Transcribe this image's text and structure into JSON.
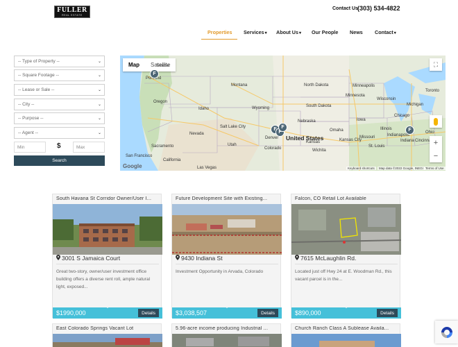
{
  "header": {
    "logo_text": "FULLER",
    "logo_sub": "REAL ESTATE",
    "contact_label": "Contact Us",
    "phone": "(303) 534-4822"
  },
  "nav": {
    "items": [
      {
        "label": "Properties",
        "active": true
      },
      {
        "label": "Services",
        "caret": "▾"
      },
      {
        "label": "About Us",
        "caret": "▾"
      },
      {
        "label": "Our People"
      },
      {
        "label": "News"
      },
      {
        "label": "Contact",
        "caret": "▾"
      }
    ]
  },
  "filters": {
    "type": "-- Type of Property --",
    "footage": "-- Square Footage --",
    "lease": "-- Lease or Sale --",
    "city": "-- City --",
    "purpose": "-- Purpose --",
    "agent": "-- Agent --",
    "min_placeholder": "Min",
    "currency": "$",
    "max_placeholder": "Max",
    "search_label": "Search",
    "dropdown_icon": "chevron-down-icon"
  },
  "map": {
    "tab_map": "Map",
    "tab_satellite": "Satellite",
    "country_label": "United States",
    "zoom_in": "+",
    "zoom_out": "−",
    "fullscreen": "⛶",
    "google": "Google",
    "attrib_shortcuts": "Keyboard shortcuts",
    "attrib_data": "Map data ©2022 Google, INEGI",
    "attrib_terms": "Terms of Use",
    "marker_glyph": "F",
    "labels": [
      "Portland",
      "Seattle",
      "Minneapolis",
      "Chicago",
      "Indianapolis",
      "Cincinnati",
      "St. Louis",
      "Denver",
      "Salt Lake City",
      "Sacramento",
      "San Francisco",
      "Las Vegas",
      "Kansas City",
      "Omaha",
      "Wichita",
      "Toronto",
      "Nebraska",
      "Kansas",
      "Iowa",
      "Illinois",
      "Missouri",
      "Wisconsin",
      "Michigan",
      "Wyoming",
      "Colorado",
      "Nevada",
      "Utah",
      "Oregon",
      "Idaho",
      "Montana",
      "South Dakota",
      "North Dakota",
      "Minnesota",
      "California",
      "Ohio",
      "Indiana"
    ]
  },
  "listings": [
    {
      "title": "South Havana St Corridor Owner/User I...",
      "address": "3001 S Jamaica Court",
      "description": "Great two-story, owner/user investment office building offers a diverse rent roll, ample natural light, exposed...",
      "price": "$1990,000",
      "details_label": "Details"
    },
    {
      "title": "Future Development Site with Existing...",
      "address": "9430 Indiana St",
      "description": "Investment Opportunity in Arvada, Colorado",
      "price": "$3,038,507",
      "details_label": "Details"
    },
    {
      "title": "Falcon, CO Retail Lot Available",
      "address": "7615 McLaughlin Rd.",
      "description": "Located just off Hwy 24 at E. Woodman Rd., this vacant parcel is in the...",
      "price": "$890,000",
      "details_label": "Details"
    }
  ],
  "listings_row2": [
    {
      "title": "East Colorado Springs Vacant Lot"
    },
    {
      "title": "5.96-acre income producing Industrial ..."
    },
    {
      "title": "Church Ranch Class A Sublease Availa..."
    }
  ],
  "colors": {
    "accent": "#e29a2b",
    "dark": "#2d4a5a",
    "price_bar": "#45c0d9"
  }
}
